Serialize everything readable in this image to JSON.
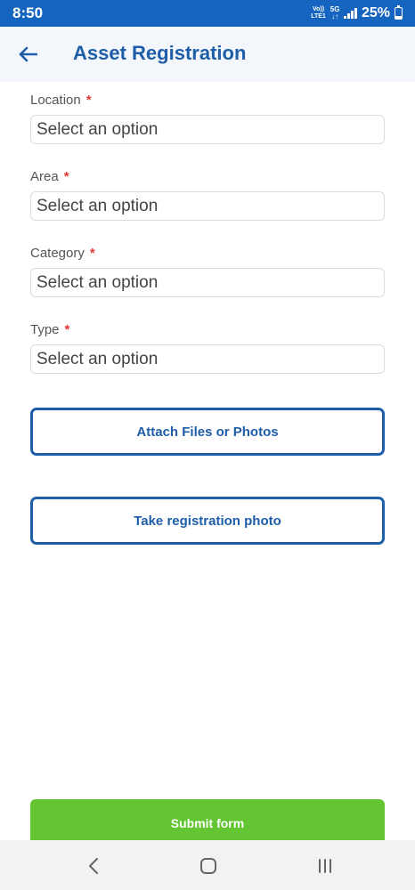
{
  "status_bar": {
    "time": "8:50",
    "volte_top": "Vo))",
    "volte_bottom": "LTE1",
    "net_top": "5G",
    "net_bottom": "↓↑",
    "battery_percent": "25%",
    "battery_level": 0.25
  },
  "header": {
    "title": "Asset Registration",
    "back_icon": "arrow-left-icon"
  },
  "form": {
    "required_marker": "*",
    "fields": [
      {
        "label": "Location",
        "value": "Select an option"
      },
      {
        "label": "Area",
        "value": "Select an option"
      },
      {
        "label": "Category",
        "value": "Select an option"
      },
      {
        "label": "Type",
        "value": "Select an option"
      }
    ],
    "attach_label": "Attach Files or Photos",
    "photo_label": "Take registration photo",
    "submit_label": "Submit form"
  },
  "nav_bar": {
    "back_icon": "chevron-left-icon",
    "home_icon": "home-icon",
    "recents_icon": "recents-icon"
  },
  "colors": {
    "status_bar": "#1565c0",
    "accent": "#1e5da8",
    "required": "#e53935",
    "submit": "#63c531"
  }
}
